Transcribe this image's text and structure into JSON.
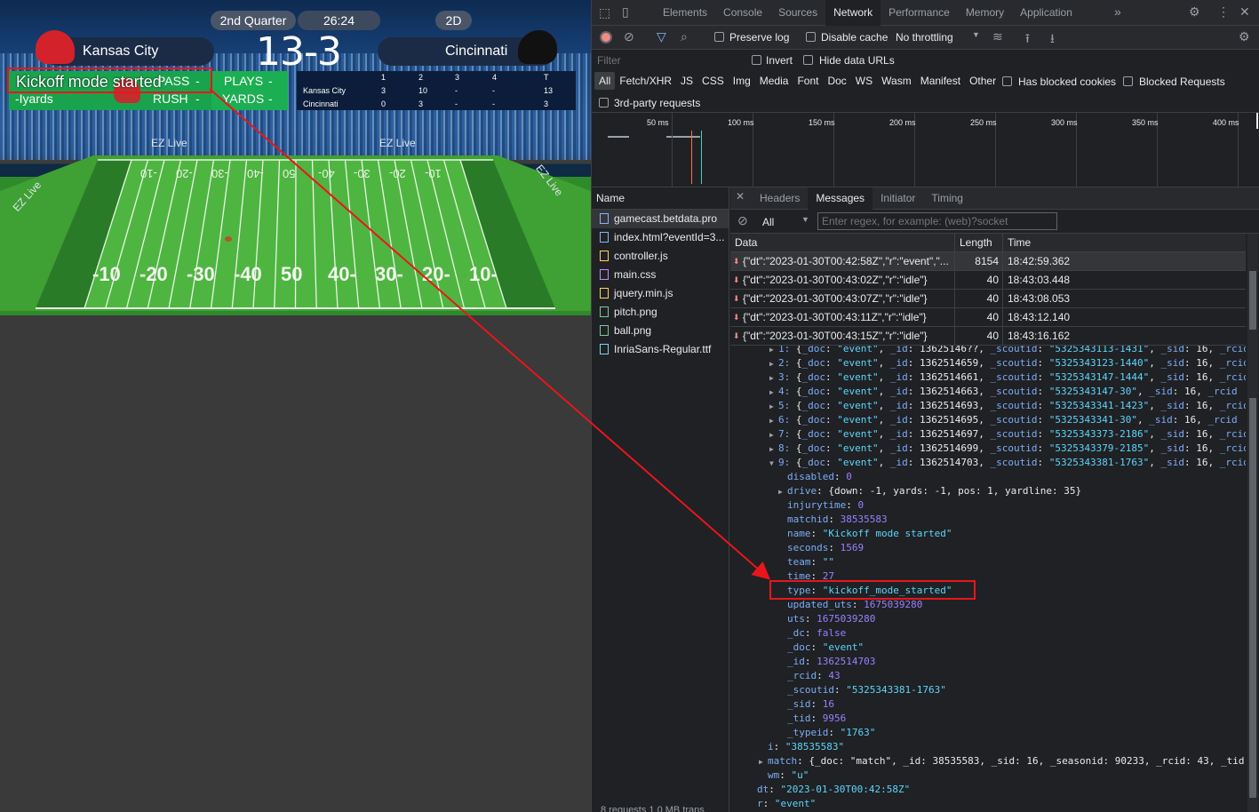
{
  "game": {
    "quarter": "2nd Quarter",
    "clock": "26:24",
    "view_mode": "2D",
    "home_team": "Kansas City",
    "away_team": "Cincinnati",
    "score": "13-3",
    "event_banner": "Kickoff mode started",
    "stats": {
      "pass": "PASS",
      "pass_val": "-",
      "plays": "PLAYS",
      "plays_val": "-",
      "yards_text": "-Iyards",
      "rush": "RUSH",
      "rush_val": "-",
      "yards": "YARDS",
      "yards_val": "-"
    },
    "quarters_table": {
      "headers": [
        "1",
        "2",
        "3",
        "4",
        "T"
      ],
      "rows": [
        {
          "team": "Kansas City",
          "scores": [
            "3",
            "10",
            "-",
            "-",
            "13"
          ]
        },
        {
          "team": "Cincinnati",
          "scores": [
            "0",
            "3",
            "-",
            "-",
            "3"
          ]
        }
      ]
    },
    "ad_label": "EZ Live",
    "yard_numbers": [
      "-10",
      "-20",
      "-30",
      "-40",
      "50",
      "40-",
      "30-",
      "20-",
      "10-"
    ],
    "yard_numbers_far": [
      "-10",
      "-20",
      "-30",
      "-40",
      "50",
      "40-",
      "30-",
      "20-",
      "10-"
    ]
  },
  "devtools": {
    "main_tabs": [
      "Elements",
      "Console",
      "Sources",
      "Network",
      "Performance",
      "Memory",
      "Application"
    ],
    "active_main_tab": "Network",
    "toolbar": {
      "preserve_log": "Preserve log",
      "disable_cache": "Disable cache",
      "throttling": "No throttling"
    },
    "filter": {
      "placeholder": "Filter",
      "invert": "Invert",
      "hide_data_urls": "Hide data URLs"
    },
    "type_filters": [
      "All",
      "Fetch/XHR",
      "JS",
      "CSS",
      "Img",
      "Media",
      "Font",
      "Doc",
      "WS",
      "Wasm",
      "Manifest",
      "Other"
    ],
    "has_blocked_cookies": "Has blocked cookies",
    "blocked_requests": "Blocked Requests",
    "third_party": "3rd-party requests",
    "timeline_ticks": [
      "50 ms",
      "100 ms",
      "150 ms",
      "200 ms",
      "250 ms",
      "300 ms",
      "350 ms",
      "400 ms"
    ],
    "name_header": "Name",
    "requests": [
      {
        "name": "gamecast.betdata.pro",
        "icon": "document-icon"
      },
      {
        "name": "index.html?eventId=3...",
        "icon": "document-icon"
      },
      {
        "name": "controller.js",
        "icon": "script-icon"
      },
      {
        "name": "main.css",
        "icon": "stylesheet-icon"
      },
      {
        "name": "jquery.min.js",
        "icon": "script-icon"
      },
      {
        "name": "pitch.png",
        "icon": "image-icon"
      },
      {
        "name": "ball.png",
        "icon": "image-icon"
      },
      {
        "name": "InriaSans-Regular.ttf",
        "icon": "font-icon"
      }
    ],
    "footer": "8 requests   1.0 MB trans",
    "detail_tabs": [
      "Headers",
      "Messages",
      "Initiator",
      "Timing"
    ],
    "active_detail_tab": "Messages",
    "msg_filter_all": "All",
    "msg_filter_placeholder": "Enter regex, for example: (web)?socket",
    "msg_columns": [
      "Data",
      "Length",
      "Time"
    ],
    "messages": [
      {
        "data": "{\"dt\":\"2023-01-30T00:42:58Z\",\"r\":\"event\",\"...",
        "length": "8154",
        "time": "18:42:59.362"
      },
      {
        "data": "{\"dt\":\"2023-01-30T00:43:02Z\",\"r\":\"idle\"}",
        "length": "40",
        "time": "18:43:03.448"
      },
      {
        "data": "{\"dt\":\"2023-01-30T00:43:07Z\",\"r\":\"idle\"}",
        "length": "40",
        "time": "18:43:08.053"
      },
      {
        "data": "{\"dt\":\"2023-01-30T00:43:11Z\",\"r\":\"idle\"}",
        "length": "40",
        "time": "18:43:12.140"
      },
      {
        "data": "{\"dt\":\"2023-01-30T00:43:15Z\",\"r\":\"idle\"}",
        "length": "40",
        "time": "18:43:16.162"
      }
    ],
    "event_rows": [
      {
        "idx": "1:",
        "id": "13625146??",
        "scoutid": "5325343113-1431"
      },
      {
        "idx": "2:",
        "id": "1362514659",
        "scoutid": "5325343123-1440"
      },
      {
        "idx": "3:",
        "id": "1362514661",
        "scoutid": "5325343147-1444"
      },
      {
        "idx": "4:",
        "id": "1362514663",
        "scoutid": "5325343147-30"
      },
      {
        "idx": "5:",
        "id": "1362514693",
        "scoutid": "5325343341-1423"
      },
      {
        "idx": "6:",
        "id": "1362514695",
        "scoutid": "5325343341-30"
      },
      {
        "idx": "7:",
        "id": "1362514697",
        "scoutid": "5325343373-2186"
      },
      {
        "idx": "8:",
        "id": "1362514699",
        "scoutid": "5325343379-2185"
      },
      {
        "idx": "9:",
        "id": "1362514703",
        "scoutid": "5325343381-1763"
      }
    ],
    "event_props": [
      {
        "key": "disabled",
        "val": "0",
        "kind": "n"
      },
      {
        "key": "drive",
        "val": "{down: -1, yards: -1, pos: 1, yardline: 35}",
        "kind": "w",
        "expandable": true
      },
      {
        "key": "injurytime",
        "val": "0",
        "kind": "n"
      },
      {
        "key": "matchid",
        "val": "38535583",
        "kind": "n"
      },
      {
        "key": "name",
        "val": "\"Kickoff mode started\"",
        "kind": "s"
      },
      {
        "key": "seconds",
        "val": "1569",
        "kind": "n"
      },
      {
        "key": "team",
        "val": "\"\"",
        "kind": "s"
      },
      {
        "key": "time",
        "val": "27",
        "kind": "n"
      },
      {
        "key": "type",
        "val": "\"kickoff_mode_started\"",
        "kind": "s"
      },
      {
        "key": "updated_uts",
        "val": "1675039280",
        "kind": "n"
      },
      {
        "key": "uts",
        "val": "1675039280",
        "kind": "n"
      },
      {
        "key": "_dc",
        "val": "false",
        "kind": "n"
      },
      {
        "key": "_doc",
        "val": "\"event\"",
        "kind": "s"
      },
      {
        "key": "_id",
        "val": "1362514703",
        "kind": "n"
      },
      {
        "key": "_rcid",
        "val": "43",
        "kind": "n"
      },
      {
        "key": "_scoutid",
        "val": "\"5325343381-1763\"",
        "kind": "s"
      },
      {
        "key": "_sid",
        "val": "16",
        "kind": "n"
      },
      {
        "key": "_tid",
        "val": "9956",
        "kind": "n"
      },
      {
        "key": "_typeid",
        "val": "\"1763\"",
        "kind": "s"
      }
    ],
    "tail_rows": [
      {
        "key": "i",
        "val": "\"38535583\"",
        "kind": "s",
        "indent": 1
      },
      {
        "key": "match",
        "val": "{_doc: \"match\", _id: 38535583, _sid: 16, _seasonid: 90233, _rcid: 43, _tid",
        "kind": "w",
        "indent": 1,
        "expandable": true
      },
      {
        "key": "wm",
        "val": "\"u\"",
        "kind": "s",
        "indent": 1
      },
      {
        "key": "dt",
        "val": "\"2023-01-30T00:42:58Z\"",
        "kind": "s",
        "indent": 0
      },
      {
        "key": "r",
        "val": "\"event\"",
        "kind": "s",
        "indent": 0
      }
    ],
    "event_common": {
      "doc": "\"event\"",
      "sid": "16",
      "rcid_tail": "_rcid"
    }
  },
  "colors": {
    "annotation_red": "#e8161c",
    "field_green": "#2e8a2a",
    "stat_green": "#17a04a",
    "record_red": "#f28b82"
  }
}
